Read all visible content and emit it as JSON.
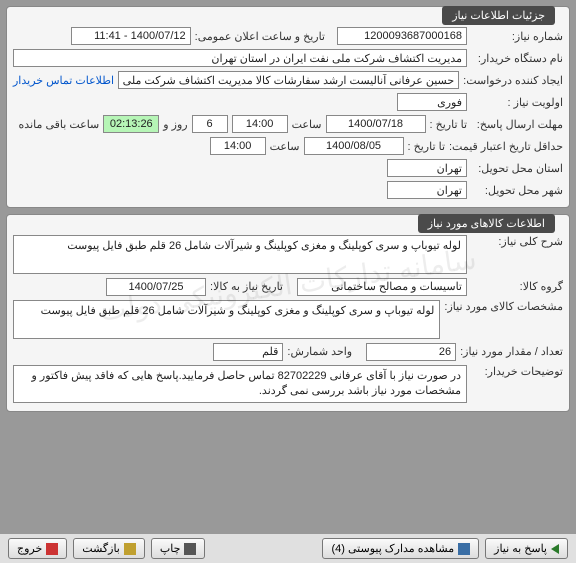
{
  "panel1": {
    "title": "جزئیات اطلاعات نیاز",
    "need_number": {
      "label": "شماره نیاز:",
      "value": "1200093687000168"
    },
    "announce": {
      "label": "تاریخ و ساعت اعلان عمومی:",
      "value": "1400/07/12 - 11:41"
    },
    "buyer": {
      "label": "نام دستگاه خریدار:",
      "value": "مدیریت اکتشاف شرکت ملی نفت ایران در استان تهران"
    },
    "requester": {
      "label": "ایجاد کننده درخواست:",
      "value": "حسین عرفانی آنالیست ارشد سفارشات کالا مدیریت اکتشاف شرکت ملی نفت",
      "link": "اطلاعات تماس خریدار"
    },
    "priority": {
      "label": "اولویت نیاز :",
      "value": "فوری"
    },
    "deadline": {
      "label": "مهلت ارسال پاسخ:",
      "to": "تا تاریخ :",
      "date": "1400/07/18",
      "time_lbl": "ساعت",
      "time": "14:00",
      "days": "6",
      "days_lbl": "روز و",
      "remain": "02:13:26",
      "remain_lbl": "ساعت باقی مانده"
    },
    "price_valid": {
      "label": "حداقل تاریخ اعتبار قیمت:",
      "to": "تا تاریخ :",
      "date": "1400/08/05",
      "time_lbl": "ساعت",
      "time": "14:00"
    },
    "province": {
      "label": "استان محل تحویل:",
      "value": "تهران"
    },
    "city": {
      "label": "شهر محل تحویل:",
      "value": "تهران"
    }
  },
  "panel2": {
    "title": "اطلاعات کالاهای مورد نیاز",
    "desc": {
      "label": "شرح کلی نیاز:",
      "value": "لوله تیوباپ و سری کوپلینگ و مغزی کوپلینگ و شیرآلات شامل 26 قلم طبق فایل پیوست"
    },
    "group": {
      "label": "گروه کالا:",
      "value": "تاسیسات و مصالح ساختمانی",
      "date_lbl": "تاریخ نیاز به کالا:",
      "date": "1400/07/25"
    },
    "spec": {
      "label": "مشخصات کالای مورد نیاز:",
      "value": "لوله تیوباپ و سری کوپلینگ و مغزی کوپلینگ و شیرآلات شامل 26 قلم طبق فایل پیوست"
    },
    "qty": {
      "label": "تعداد / مقدار مورد نیاز:",
      "value": "26",
      "unit_lbl": "واحد شمارش:",
      "unit": "قلم"
    },
    "notes": {
      "label": "توضیحات خریدار:",
      "value": "در صورت نیاز با آقای عرفانی 82702229 تماس حاصل فرمایید.پاسخ هایی که فاقد پیش فاکتور و مشخصات مورد نیاز باشد بررسی نمی گردند."
    }
  },
  "buttons": {
    "respond": "پاسخ به نیاز",
    "docs": "مشاهده مدارک پیوستی (4)",
    "print": "چاپ",
    "back": "بازگشت",
    "exit": "خروج"
  },
  "watermark": "سامانه تدارکات الکترونیکی دولت"
}
